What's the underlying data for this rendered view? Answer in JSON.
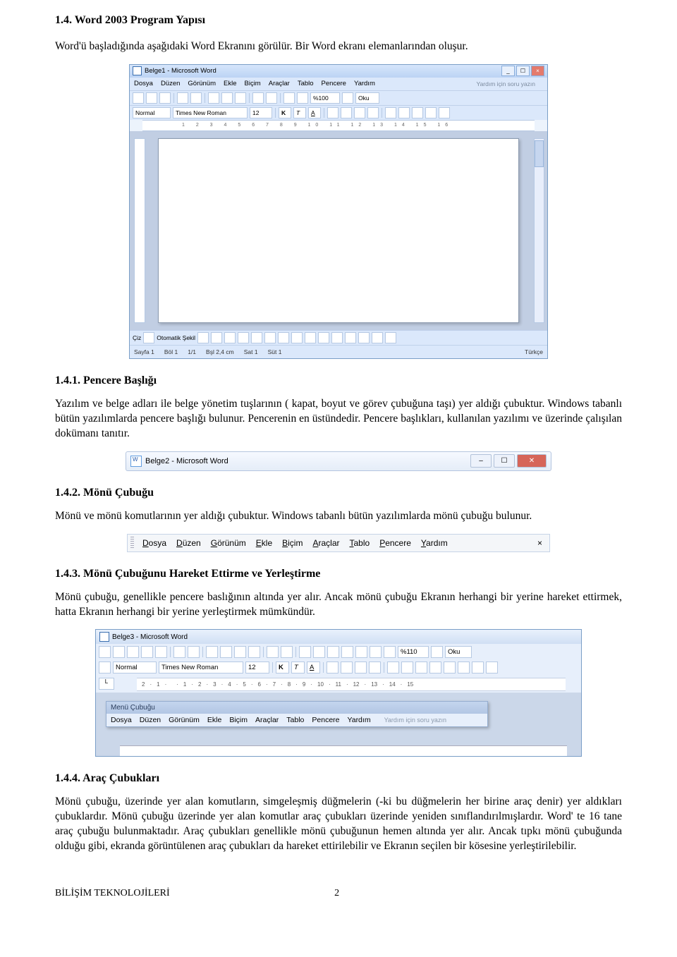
{
  "sec14": {
    "heading": "1.4. Word 2003 Program Yapısı",
    "intro": "Word'ü başladığında aşağıdaki Word Ekranını görülür. Bir Word ekranı elemanlarından oluşur."
  },
  "word_full": {
    "title": "Belge1 - Microsoft Word",
    "menus": [
      "Dosya",
      "Düzen",
      "Görünüm",
      "Ekle",
      "Biçim",
      "Araçlar",
      "Tablo",
      "Pencere",
      "Yardım"
    ],
    "search_hint": "Yardım için soru yazın",
    "style": "Normal",
    "font": "Times New Roman",
    "size": "12",
    "bold": "K",
    "italic": "T",
    "under": "A",
    "zoom": "%100",
    "oku": "Oku",
    "draw_label": "Çiz",
    "autoshape": "Otomatik Şekil",
    "status": {
      "page": "Sayfa 1",
      "sec": "Böl 1",
      "pp": "1/1",
      "at": "Bşl 2,4 cm",
      "ln": "Sat 1",
      "col": "Süt 1",
      "lang": "Türkçe"
    }
  },
  "sec141": {
    "heading": "1.4.1. Pencere Başlığı",
    "p": "Yazılım ve belge adları ile belge yönetim tuşlarının ( kapat, boyut ve görev çubuğuna taşı) yer aldığı çubuktur. Windows tabanlı bütün yazılımlarda pencere başlığı bulunur. Pencerenin en üstündedir. Pencere başlıkları, kullanılan yazılımı ve üzerinde çalışılan dokümanı tanıtır."
  },
  "titlebar": {
    "title": "Belge2 - Microsoft Word",
    "min": "–",
    "max": "☐",
    "close": "✕"
  },
  "sec142": {
    "heading": "1.4.2. Mönü Çubuğu",
    "p": "Mönü ve mönü komutlarının yer aldığı çubuktur. Windows tabanlı bütün yazılımlarda mönü çubuğu bulunur."
  },
  "menubar": {
    "items": [
      {
        "u": "D",
        "rest": "osya"
      },
      {
        "u": "D",
        "rest": "üzen"
      },
      {
        "u": "G",
        "rest": "örünüm"
      },
      {
        "u": "E",
        "rest": "kle"
      },
      {
        "u": "B",
        "rest": "içim"
      },
      {
        "u": "A",
        "rest": "raçlar"
      },
      {
        "u": "T",
        "rest": "ablo"
      },
      {
        "u": "P",
        "rest": "encere"
      },
      {
        "u": "Y",
        "rest": "ardım"
      }
    ],
    "x": "×"
  },
  "sec143": {
    "heading": "1.4.3. Mönü Çubuğunu Hareket Ettirme ve Yerleştirme",
    "p": "Mönü çubuğu, genellikle pencere baslığının altında yer alır. Ancak mönü çubuğu Ekranın herhangi bir yerine hareket ettirmek, hatta Ekranın herhangi bir yerine yerleştirmek mümkündür."
  },
  "word_part": {
    "title": "Belge3 - Microsoft Word",
    "style": "Normal",
    "font": "Times New Roman",
    "size": "12",
    "bold": "K",
    "italic": "T",
    "under": "A",
    "zoom": "%110",
    "oku": "Oku",
    "float_title": "Menü Çubuğu",
    "menus": [
      "Dosya",
      "Düzen",
      "Görünüm",
      "Ekle",
      "Biçim",
      "Araçlar",
      "Tablo",
      "Pencere",
      "Yardım"
    ],
    "search_hint": "Yardım için soru yazın",
    "ruler": [
      "2",
      "1",
      "",
      "1",
      "2",
      "3",
      "4",
      "5",
      "6",
      "7",
      "8",
      "9",
      "10",
      "11",
      "12",
      "13",
      "14",
      "15"
    ]
  },
  "sec144": {
    "heading": "1.4.4. Araç Çubukları",
    "p": "Mönü çubuğu, üzerinde yer alan komutların, simgeleşmiş düğmelerin (-ki bu düğmelerin her birine araç denir) yer aldıkları çubuklardır. Mönü çubuğu üzerinde yer alan komutlar araç çubukları üzerinde yeniden sınıflandırılmışlardır. Word' te 16 tane araç çubuğu bulunmaktadır. Araç çubukları genellikle mönü çubuğunun hemen altında yer alır. Ancak tıpkı mönü çubuğunda olduğu gibi, ekranda görüntülenen araç çubukları da hareket ettirilebilir ve Ekranın seçilen bir kösesine yerleştirilebilir."
  },
  "footer": {
    "left": "BİLİŞİM TEKNOLOJİLERİ",
    "page": "2"
  }
}
